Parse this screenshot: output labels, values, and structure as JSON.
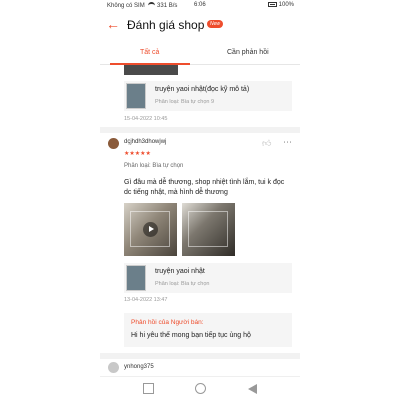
{
  "status_bar": {
    "carrier": "Không có SIM",
    "speed": "331 B/s",
    "time": "6:06",
    "battery": "100%"
  },
  "header": {
    "title": "Đánh giá shop -",
    "badge": "New",
    "back_icon": "back-arrow-icon"
  },
  "tabs": [
    {
      "label": "Tất cả",
      "active": true
    },
    {
      "label": "Cần phản hồi",
      "active": false
    }
  ],
  "previous_review": {
    "product": {
      "name": "truyện yaoi nhật(đọc kỹ mô tả)",
      "variant": "Phân loại: Bìa tự chọn 9"
    },
    "date": "15-04-2022 10:45"
  },
  "review": {
    "username": "dçjhdh3dhowjwj",
    "rating": 5,
    "stars": "★★★★★",
    "variant": "Phân loại: Bìa tự chọn",
    "comment": "Gì đâu mà dễ thương, shop nhiệt tình lắm, tui k đọc dc tiếng nhật, mà hình dễ thương",
    "photo_count": 2,
    "has_video": true,
    "product": {
      "name": "truyện yaoi nhật",
      "variant": "Phân loại: Bìa tự chọn"
    },
    "date": "13-04-2022 13:47",
    "seller_reply": {
      "label": "Phản hồi của Người bán:",
      "text": "Hi hi yêu thế mong bạn tiếp tục ủng hộ"
    }
  },
  "next_review": {
    "username": "ynhong375"
  },
  "colors": {
    "accent": "#ee4d2d",
    "muted": "#999999",
    "box_bg": "#f5f5f5"
  }
}
